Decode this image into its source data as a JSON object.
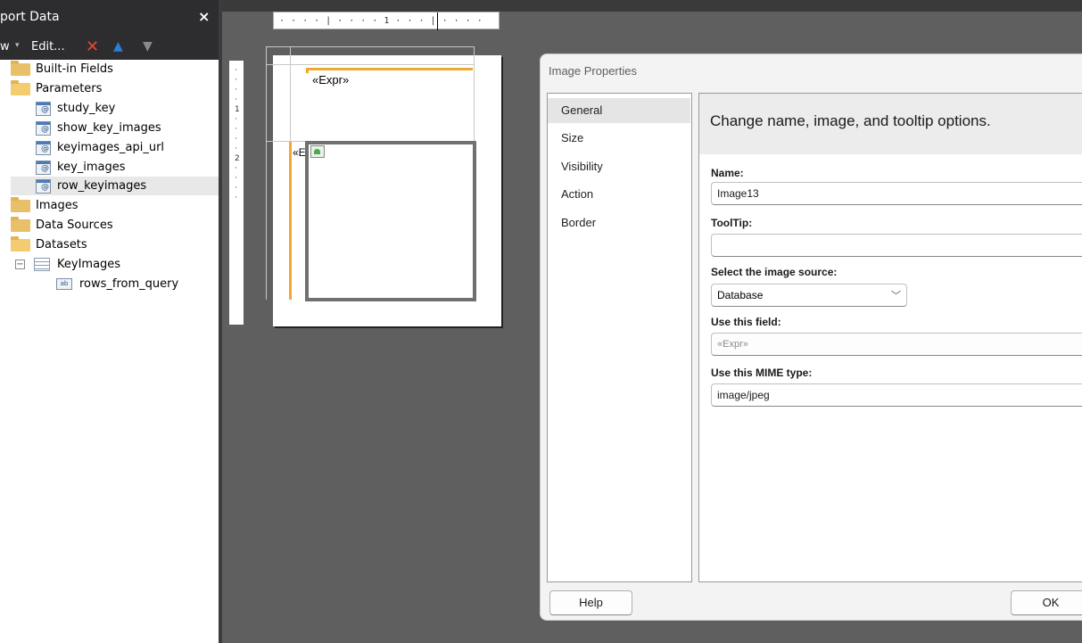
{
  "left_panel": {
    "title": "port Data",
    "close_glyph": "×",
    "toolbar": {
      "new_label": "w",
      "caret": "▾",
      "edit_label": "Edit...",
      "delete_icon": "close-x-icon",
      "up_icon": "arrow-up-icon",
      "down_icon": "arrow-down-icon"
    },
    "tree": {
      "built_in_fields": "Built-in Fields",
      "parameters": "Parameters",
      "params": [
        "study_key",
        "show_key_images",
        "keyimages_api_url",
        "key_images",
        "row_keyimages"
      ],
      "images": "Images",
      "data_sources": "Data Sources",
      "datasets": "Datasets",
      "dataset_name": "KeyImages",
      "dataset_field": "rows_from_query",
      "expander_glyph": "−"
    }
  },
  "design": {
    "ruler_ticks": "· · · · | · · · · 1 · · · | · · · ·",
    "ruler_vertical": "· · · · 1 · · · · 2 · · · ·",
    "header_expr": "«Expr»",
    "truncated_expr": "«E"
  },
  "dialog": {
    "title": "Image Properties",
    "nav": [
      "General",
      "Size",
      "Visibility",
      "Action",
      "Border"
    ],
    "active_nav": "General",
    "heading": "Change name, image, and tooltip options.",
    "name_label": "Name:",
    "name_value": "Image13",
    "tooltip_label": "ToolTip:",
    "tooltip_value": "",
    "source_label": "Select the image source:",
    "source_value": "Database",
    "field_label": "Use this field:",
    "field_value": "«Expr»",
    "mime_label": "Use this MIME type:",
    "mime_value": "image/jpeg",
    "help_label": "Help",
    "ok_label": "OK"
  },
  "colors": {
    "selection_orange": "#f0a830",
    "panel_dark": "#2d2d30",
    "canvas_gray": "#5f5f5f"
  }
}
